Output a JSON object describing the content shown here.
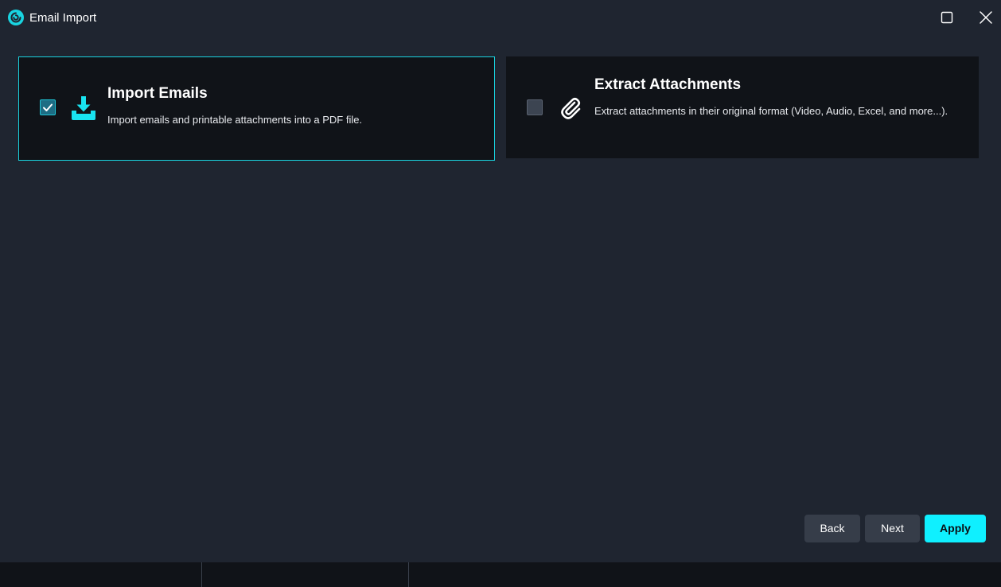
{
  "window": {
    "title": "Email Import",
    "logo_icon": "app-logo-icon",
    "maximize_icon": "maximize-icon",
    "close_icon": "close-icon"
  },
  "options": {
    "import": {
      "title": "Import Emails",
      "description": "Import emails and printable attachments into a PDF file.",
      "checked": true,
      "icon": "download-tray-icon"
    },
    "extract": {
      "title": "Extract Attachments",
      "description": "Extract attachments in their original format (Video, Audio, Excel, and more...).",
      "checked": false,
      "icon": "paperclip-icon"
    }
  },
  "footer": {
    "back_label": "Back",
    "next_label": "Next",
    "apply_label": "Apply"
  },
  "colors": {
    "accent": "#0ff0ff",
    "background": "#1f2530",
    "card_background": "#101318",
    "button_secondary": "#363d49"
  }
}
